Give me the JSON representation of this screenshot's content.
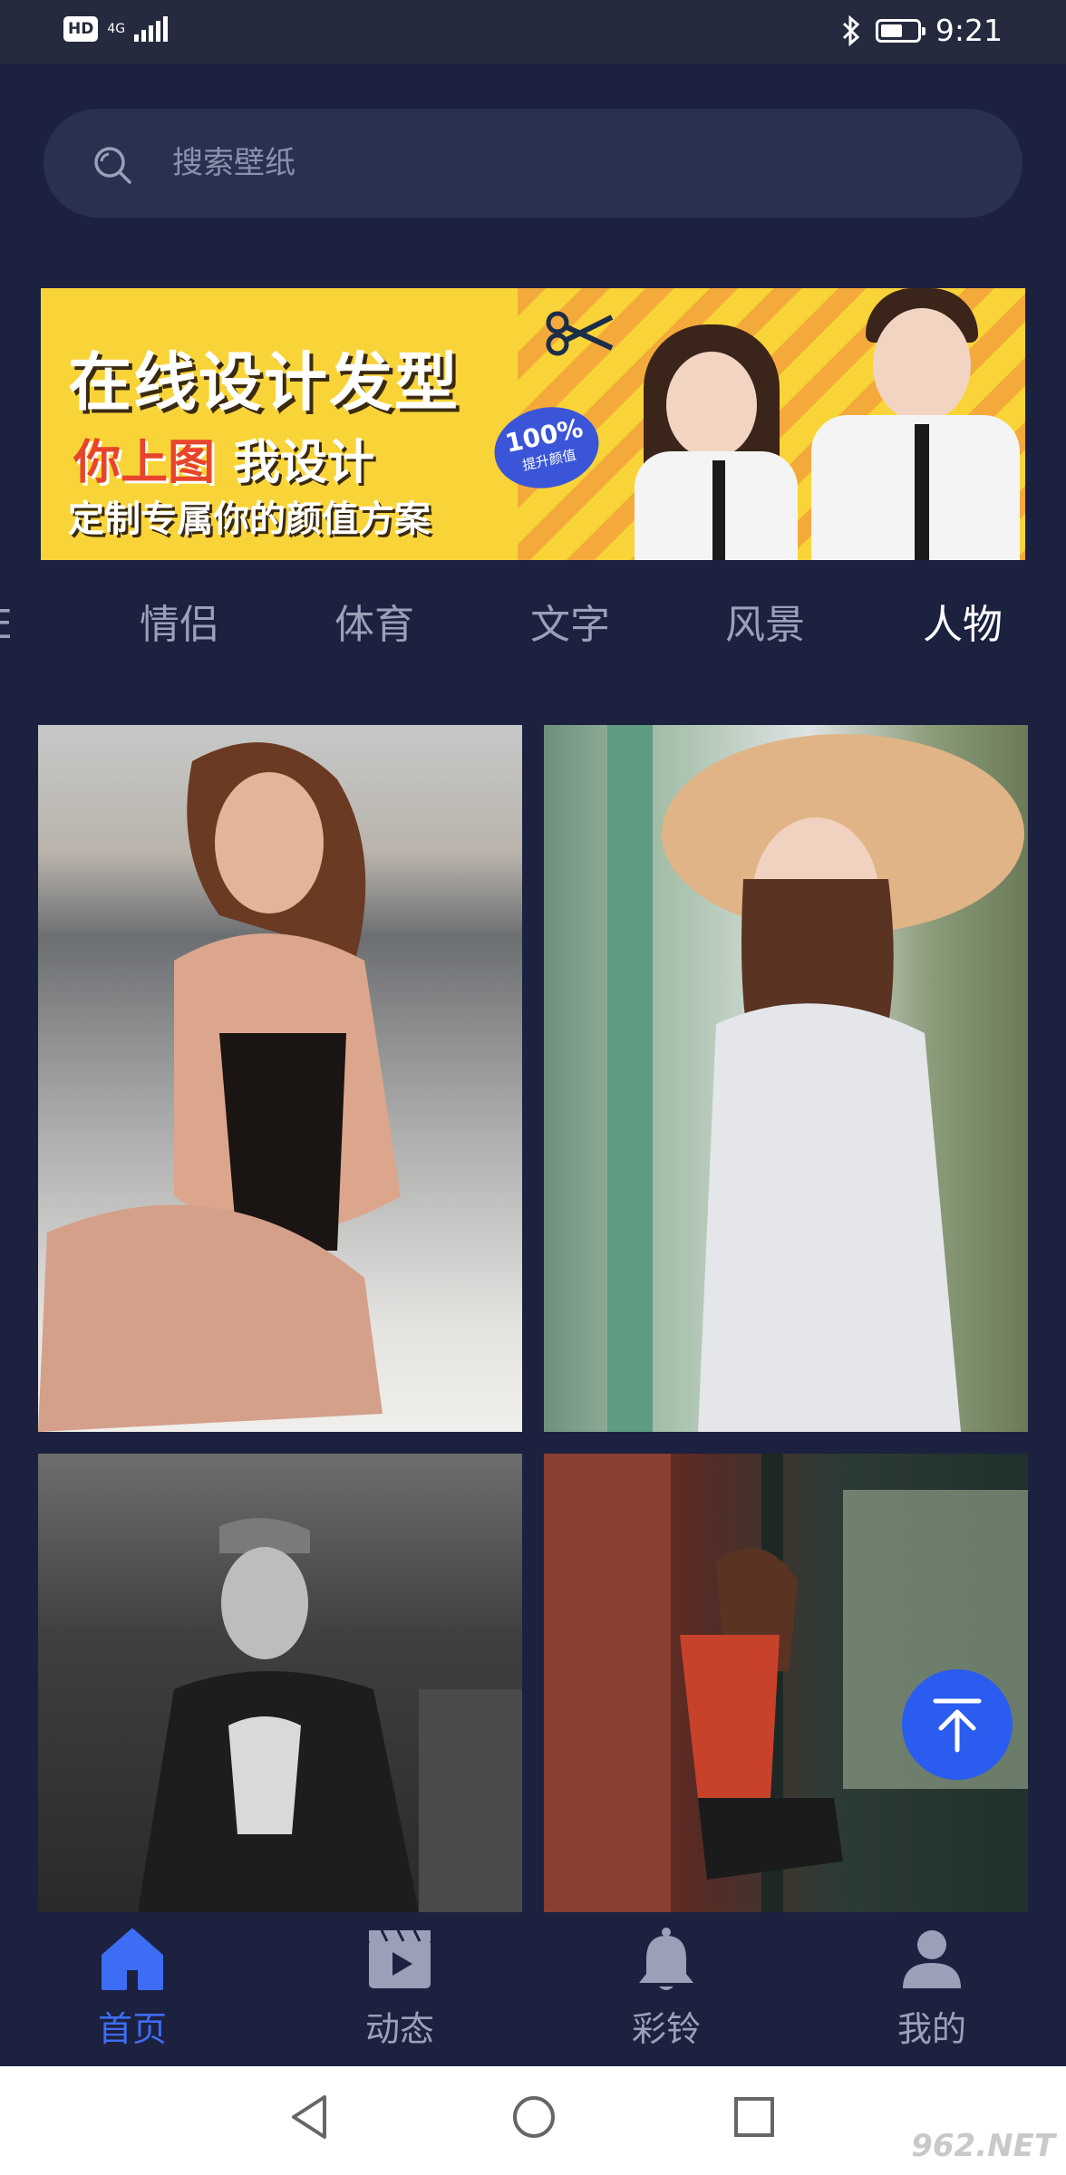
{
  "status_bar": {
    "hd": "HD",
    "network": "4G",
    "time": "9:21",
    "battery_level": 0.6
  },
  "search": {
    "placeholder": "搜索壁纸"
  },
  "banner": {
    "title": "在线设计发型",
    "sub_red": "你上图",
    "sub_white": "我设计",
    "description": "定制专属你的颜值方案",
    "badge_pct": "100%",
    "badge_text": "提升颜值"
  },
  "categories": {
    "items": [
      "情侣",
      "体育",
      "文字",
      "风景",
      "人物"
    ],
    "partial_left": "E",
    "active": "人物"
  },
  "bottom_nav": {
    "items": [
      {
        "label": "首页",
        "icon": "home-icon",
        "active": true
      },
      {
        "label": "动态",
        "icon": "video-icon",
        "active": false
      },
      {
        "label": "彩铃",
        "icon": "bell-icon",
        "active": false
      },
      {
        "label": "我的",
        "icon": "user-icon",
        "active": false
      }
    ]
  },
  "watermark": "962.NET",
  "colors": {
    "background": "#1c2140",
    "accent": "#3d6df5",
    "search_bg": "#2a3150",
    "banner_bg": "#f9d438"
  }
}
